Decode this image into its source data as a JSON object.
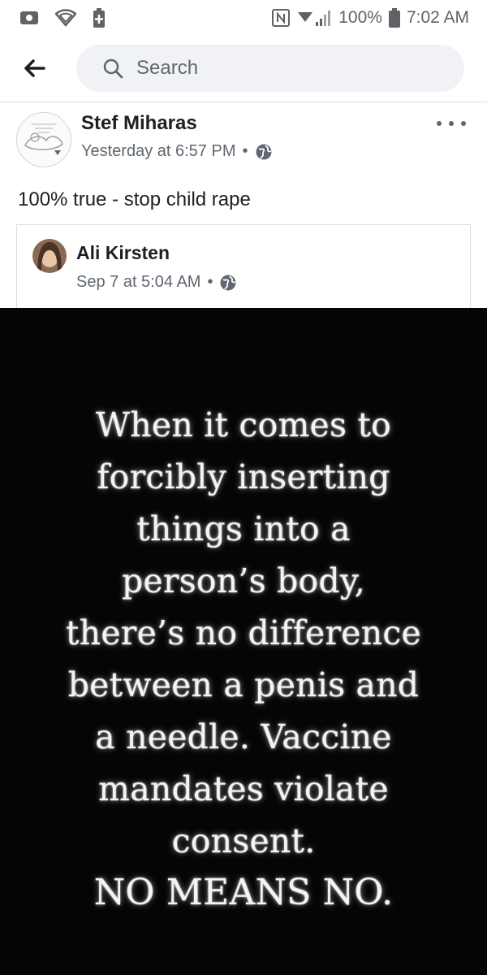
{
  "status_bar": {
    "battery": "100%",
    "time": "7:02 AM",
    "icons": [
      "message-icon",
      "wifi-icon",
      "battery-saver-icon",
      "nfc-icon",
      "signal-icon",
      "battery-icon"
    ]
  },
  "search": {
    "placeholder": "Search"
  },
  "post": {
    "author": "Stef Miharas",
    "timestamp": "Yesterday at 6:57 PM",
    "privacy_icon": "globe-icon",
    "text": "100% true - stop child rape"
  },
  "shared_post": {
    "author": "Ali Kirsten",
    "timestamp": "Sep 7 at 5:04 AM",
    "privacy_icon": "globe-icon",
    "image_text": [
      "When it comes to",
      "forcibly inserting",
      "things into a",
      "person’s body,",
      "there’s no difference",
      "between a penis and",
      "a needle. Vaccine",
      "mandates violate",
      "consent.",
      "NO MEANS NO."
    ]
  },
  "colors": {
    "search_bg": "#f0f2f5",
    "meta_text": "#606770",
    "meme_bg": "#050505"
  }
}
